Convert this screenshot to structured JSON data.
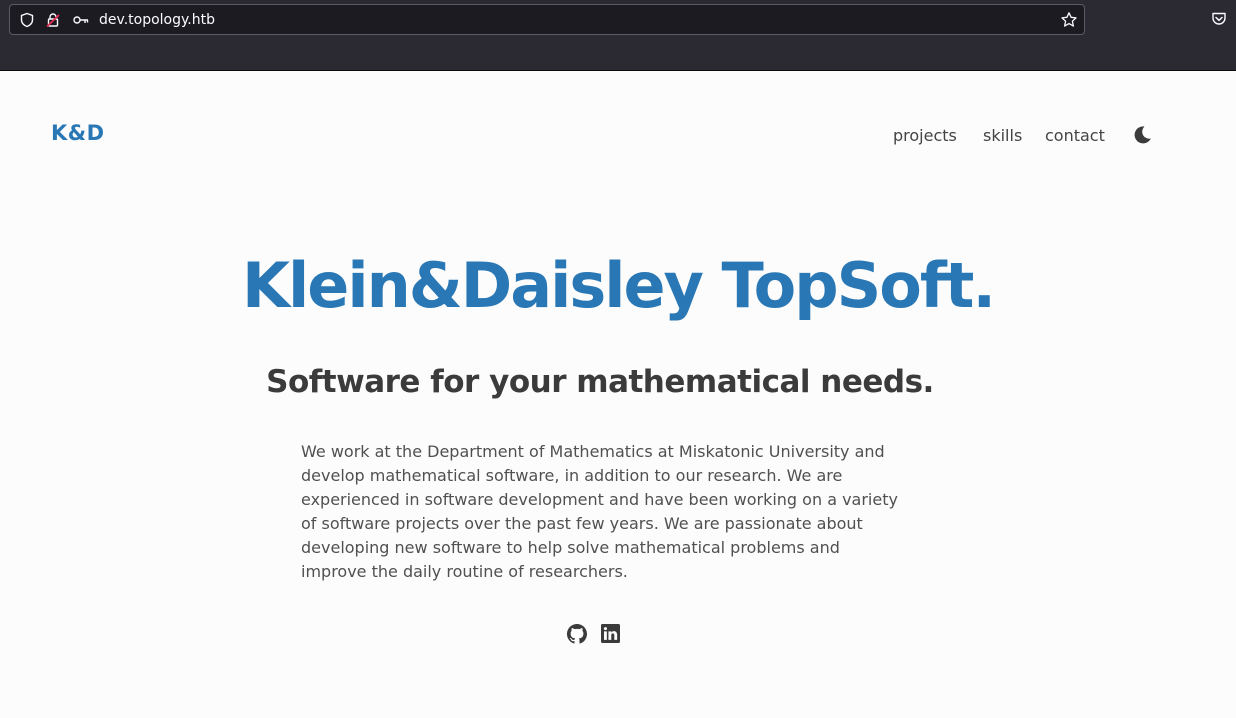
{
  "browser": {
    "url": "dev.topology.htb",
    "icons": [
      "shield-icon",
      "insecure-lock-icon",
      "key-icon",
      "star-icon",
      "pocket-icon"
    ]
  },
  "site": {
    "logo": "K&D",
    "nav": [
      {
        "label": "projects"
      },
      {
        "label": "skills"
      },
      {
        "label": "contact"
      }
    ],
    "theme_toggle_icon": "moon-icon"
  },
  "hero": {
    "title": "Klein&Daisley TopSoft.",
    "subtitle": "Software for your mathematical needs.",
    "description": "We work at the Department of Mathematics at Miskatonic University and develop mathematical software, in addition to our research. We are experienced in software development and have been working on a variety of software projects over the past few years. We are passionate about developing new software to help solve mathematical problems and improve the daily routine of researchers.",
    "socials": [
      "github-icon",
      "linkedin-icon"
    ]
  },
  "colors": {
    "accent": "#2978b5",
    "text": "#3b3b3b",
    "background": "#fcfcfc",
    "chrome": "#2b2a33"
  }
}
